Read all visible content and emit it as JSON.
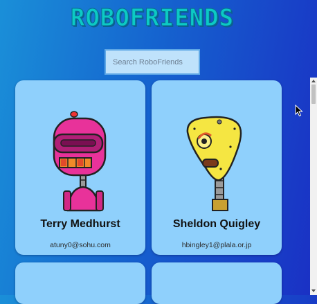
{
  "app": {
    "title": "ROBOFRIENDS"
  },
  "search": {
    "placeholder": "Search RoboFriends",
    "value": ""
  },
  "cards": [
    {
      "name": "Terry Medhurst",
      "email": "atuny0@sohu.com",
      "robot_color": "#e8329a"
    },
    {
      "name": "Sheldon Quigley",
      "email": "hbingley1@plala.or.jp",
      "robot_color": "#f5e642"
    },
    {
      "name": "",
      "email": ""
    },
    {
      "name": "",
      "email": ""
    }
  ],
  "icons": {
    "cursor": "mouse-pointer-icon"
  }
}
